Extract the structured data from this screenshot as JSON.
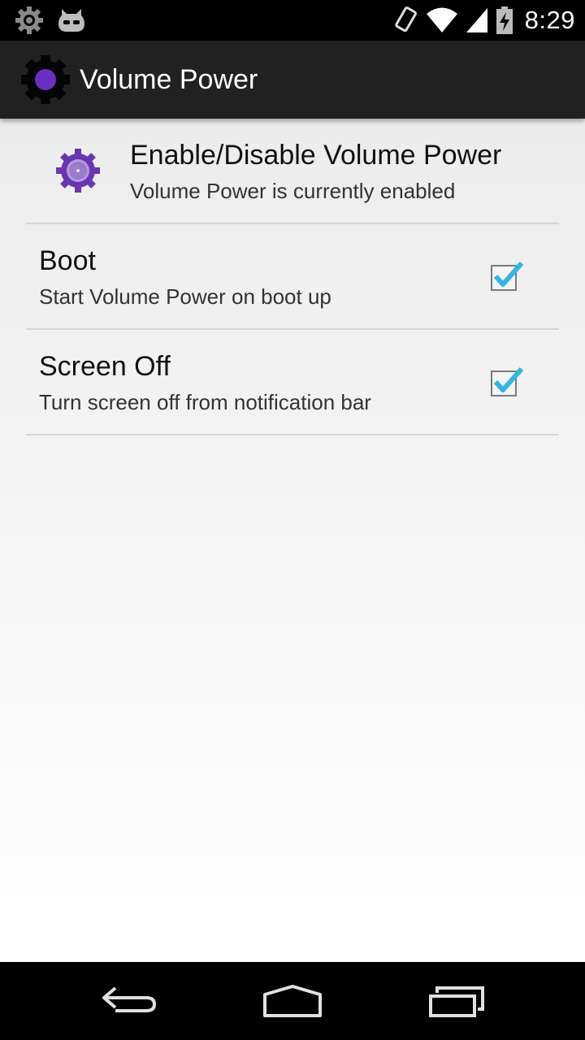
{
  "status_bar": {
    "time": "8:29",
    "icons": [
      "settings-notification-icon",
      "cyanogenmod-notification-icon",
      "rotation-icon",
      "wifi-icon",
      "signal-icon",
      "battery-charging-icon"
    ]
  },
  "action_bar": {
    "title": "Volume Power",
    "icon": "app-gear-icon"
  },
  "preferences": [
    {
      "title": "Enable/Disable Volume Power",
      "summary": "Volume Power is currently enabled",
      "icon": "purple-gear-icon"
    },
    {
      "title": "Boot",
      "summary": "Start Volume Power on boot up",
      "checked": true
    },
    {
      "title": "Screen Off",
      "summary": "Turn screen off from notification bar",
      "checked": true
    }
  ],
  "nav_bar": {
    "buttons": [
      "back-icon",
      "home-icon",
      "recents-icon"
    ]
  },
  "colors": {
    "accent": "#33b5e5",
    "purple": "#6a35b3",
    "action_bar": "#212121"
  }
}
